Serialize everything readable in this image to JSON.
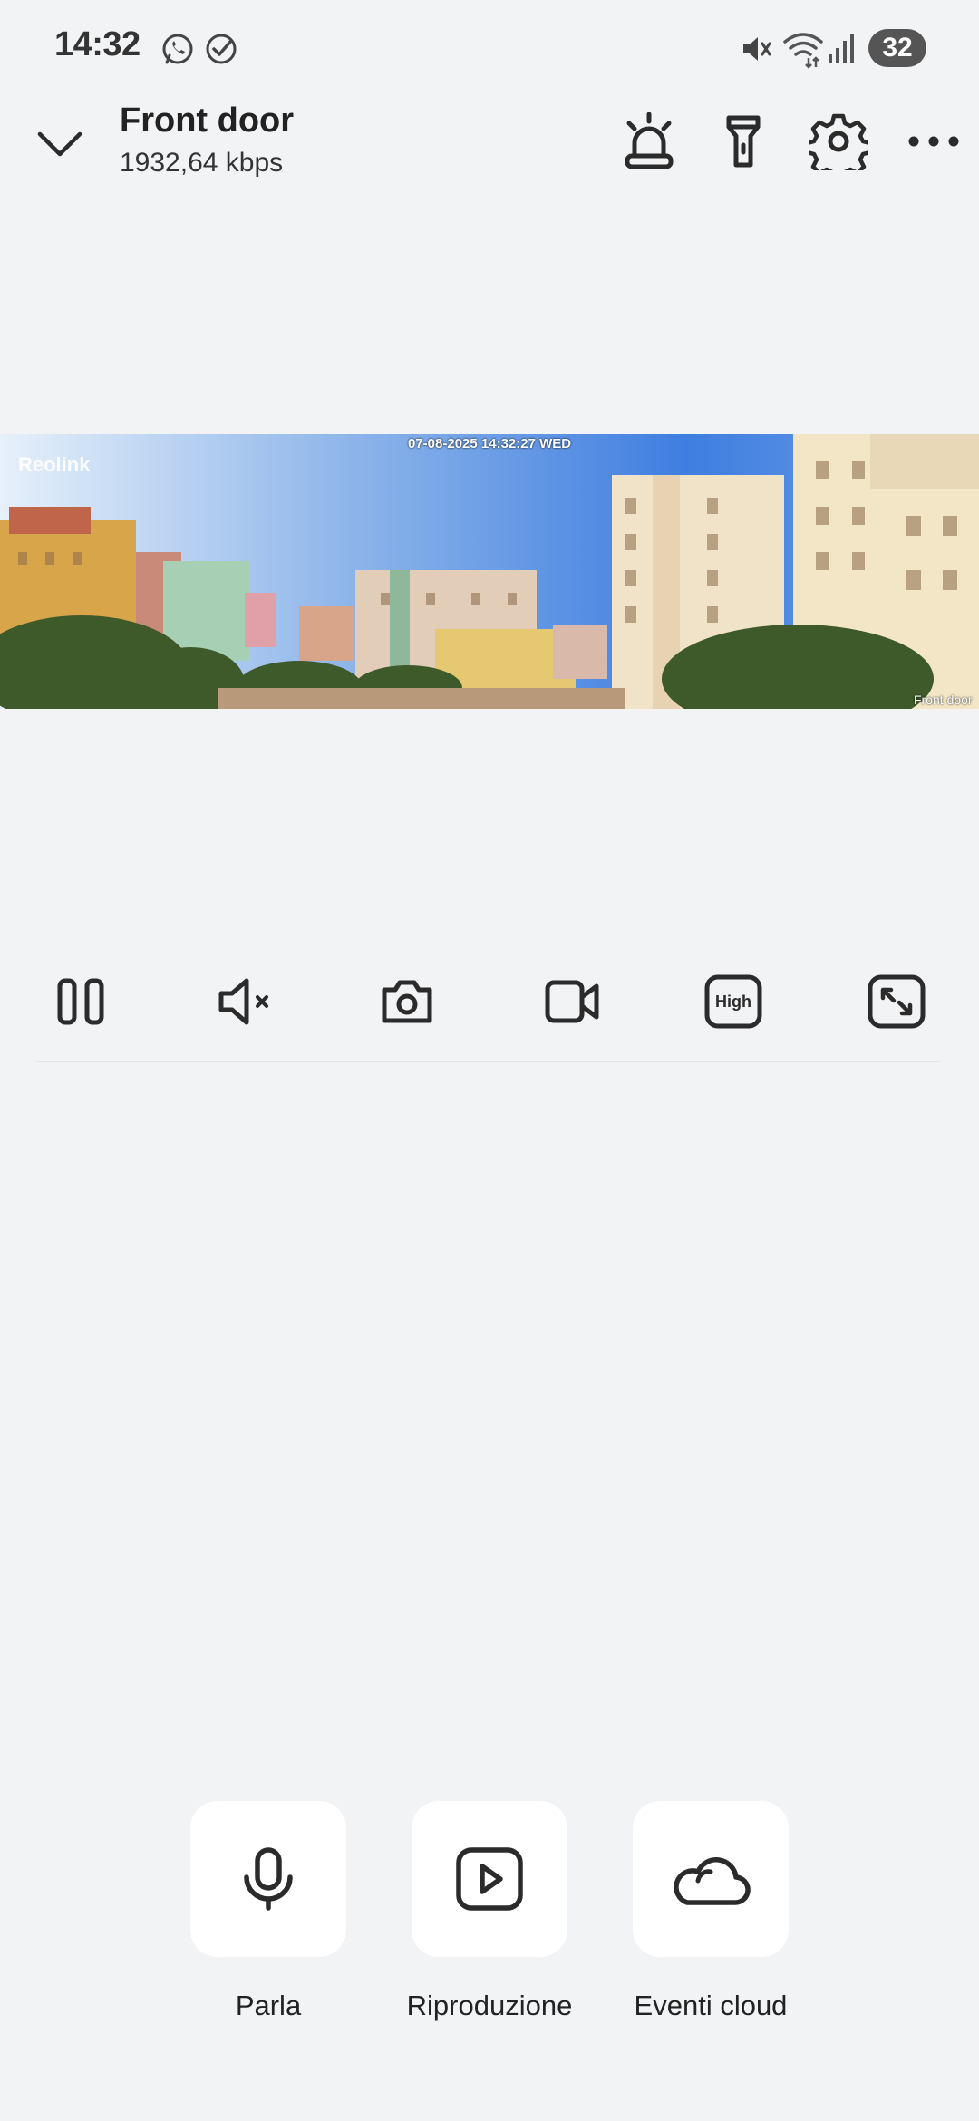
{
  "status_bar": {
    "time": "14:32",
    "battery": "32",
    "icons": [
      "whatsapp-icon",
      "check-circle-icon",
      "mute-icon",
      "wifi-icon",
      "signal-icon"
    ]
  },
  "header": {
    "title": "Front door",
    "bitrate": "1932,64 kbps",
    "icons": [
      "chevron-down-icon",
      "siren-icon",
      "flashlight-icon",
      "gear-icon",
      "more-icon"
    ]
  },
  "video": {
    "overlay_timestamp": "07-08-2025 14:32:27 WED",
    "logo": "Reolink",
    "camera_label": "Front door"
  },
  "controls": {
    "quality_label": "High",
    "icons": [
      "pause-icon",
      "speaker-muted-icon",
      "camera-snapshot-icon",
      "video-record-icon",
      "quality-high-icon",
      "fullscreen-icon"
    ]
  },
  "actions": [
    {
      "label": "Parla",
      "icon": "microphone-icon"
    },
    {
      "label": "Riproduzione",
      "icon": "play-icon"
    },
    {
      "label": "Eventi cloud",
      "icon": "cloud-icon"
    }
  ],
  "colors": {
    "background": "#f2f3f5",
    "icon": "#2b2b2b",
    "card": "#ffffff"
  }
}
